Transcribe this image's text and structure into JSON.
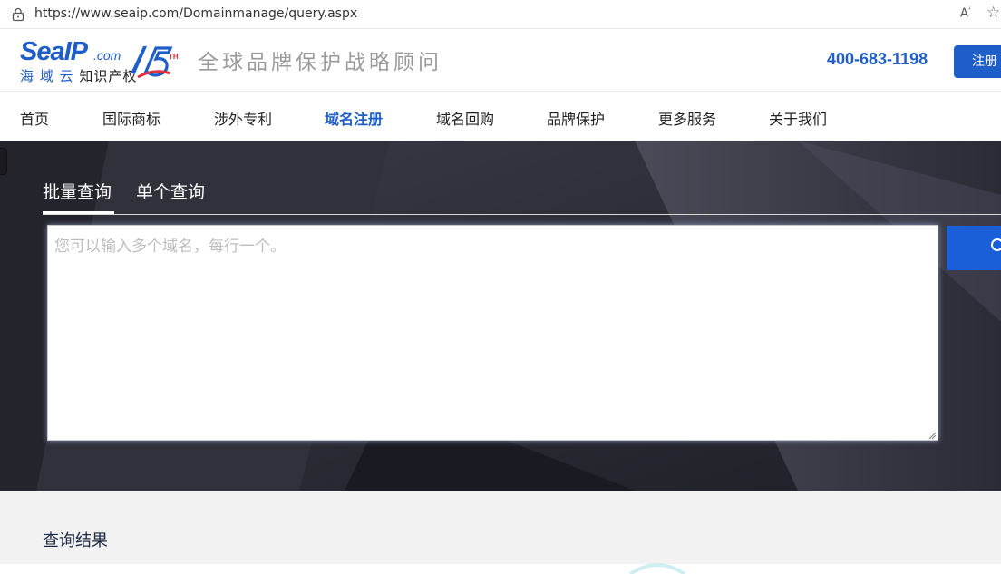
{
  "browser": {
    "url": "https://www.seaip.com/Domainmanage/query.aspx",
    "read_aloud_icon": "read-aloud-icon",
    "favorite_icon": "star-icon"
  },
  "header": {
    "logo_word_a": "Sea",
    "logo_word_b": "IP",
    "logo_com": ".com",
    "logo_cn_a": "海 域 云",
    "logo_cn_b": "知识产权",
    "anniversary_num": "15",
    "anniversary_th": "TH",
    "slogan": "全球品牌保护战略顾问",
    "phone": "400-683-1198",
    "register_label": "注册"
  },
  "nav": {
    "items": [
      {
        "label": "首页"
      },
      {
        "label": "国际商标"
      },
      {
        "label": "涉外专利"
      },
      {
        "label": "域名注册"
      },
      {
        "label": "域名回购"
      },
      {
        "label": "品牌保护"
      },
      {
        "label": "更多服务"
      },
      {
        "label": "关于我们"
      }
    ],
    "active_index": 3
  },
  "query": {
    "tabs": [
      {
        "label": "批量查询"
      },
      {
        "label": "单个查询"
      }
    ],
    "active_tab": 0,
    "textarea_placeholder": "您可以输入多个域名，每行一个。",
    "textarea_value": ""
  },
  "results": {
    "title": "查询结果"
  },
  "colors": {
    "brand_blue": "#1f5ec8",
    "search_blue": "#1a5fd8",
    "hero_dark": "#2b2c36",
    "results_bg": "#f2f2f2"
  }
}
